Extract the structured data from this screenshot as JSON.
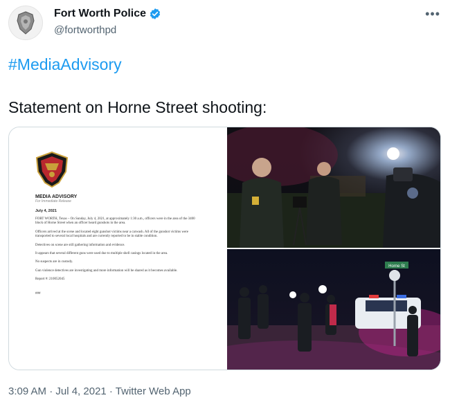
{
  "tweet": {
    "display_name": "Fort Worth Police",
    "verified": true,
    "handle": "@fortworthpd",
    "more_label": "•••",
    "hashtag": "#MediaAdvisory",
    "text": "Statement on Horne Street shooting:",
    "timestamp": "3:09 AM · Jul 4, 2021 · Twitter Web App"
  },
  "document": {
    "title": "MEDIA ADVISORY",
    "subtitle": "For Immediate Release",
    "date": "July 4, 2021",
    "paragraphs": [
      "FORT WORTH, Texas – On Sunday, July 4, 2021, at approximately 1:30 a.m., officers were in the area of the 3400 block of Horne Street when an officer heard gunshots in the area.",
      "Officers arrived at the scene and located eight gunshot victims near a carwash. All of the gunshot victims were transported to several local hospitals and are currently reported to be in stable condition.",
      "Detectives on scene are still gathering information and evidence.",
      "It appears that several different guns were used due to multiple shell casings located in the area.",
      "No suspects are in custody.",
      "Gun violence detectives are investigating and more information will be shared as it becomes available.",
      "Report #: 210052045"
    ],
    "end_marks": "###"
  },
  "photos": {
    "street_sign": "Horne St"
  },
  "colors": {
    "link": "#1d9bf0",
    "secondary_text": "#536471",
    "verified": "#1d9bf0"
  }
}
